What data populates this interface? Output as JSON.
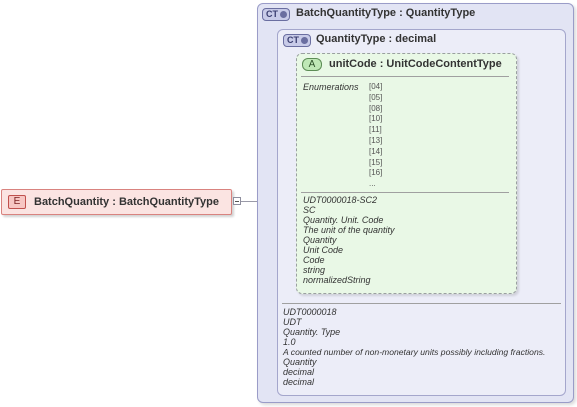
{
  "element": {
    "badge": "E",
    "label": "BatchQuantity : BatchQuantityType"
  },
  "outer_type": {
    "badge": "CT",
    "title": "BatchQuantityType : QuantityType"
  },
  "inner_type": {
    "badge": "CT",
    "title": "QuantityType : decimal",
    "annotations": [
      "UDT0000018",
      "UDT",
      "Quantity. Type",
      "1.0",
      "A counted number of non-monetary units possibly including fractions.",
      "Quantity",
      "decimal",
      "decimal"
    ]
  },
  "attribute": {
    "badge": "A",
    "title": "unitCode : UnitCodeContentType",
    "enumerations_label": "Enumerations",
    "enumerations": [
      "[04]",
      "[05]",
      "[08]",
      "[10]",
      "[11]",
      "[13]",
      "[14]",
      "[15]",
      "[16]",
      "..."
    ],
    "annotations": [
      "UDT0000018-SC2",
      "SC",
      "Quantity. Unit. Code",
      "The unit of the quantity",
      "Quantity",
      "Unit Code",
      "Code",
      "string",
      "normalizedString"
    ]
  }
}
